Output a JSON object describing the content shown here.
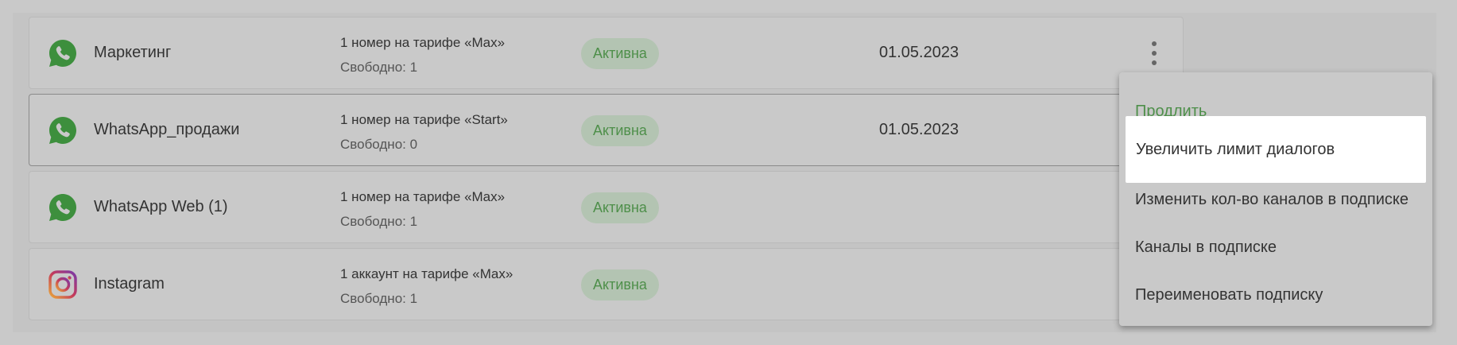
{
  "subscriptions": [
    {
      "icon": "whatsapp-icon",
      "name": "Маркетинг",
      "plan": "1 номер на тарифе «Max»",
      "free": "Свободно: 1",
      "status": "Активна",
      "date": "01.05.2023"
    },
    {
      "icon": "whatsapp-icon",
      "name": "WhatsApp_продажи",
      "plan": "1 номер на тарифе «Start»",
      "free": "Свободно: 0",
      "status": "Активна",
      "date": "01.05.2023"
    },
    {
      "icon": "whatsapp-icon",
      "name": "WhatsApp Web (1)",
      "plan": "1 номер на тарифе «Max»",
      "free": "Свободно: 1",
      "status": "Активна",
      "date": ""
    },
    {
      "icon": "instagram-icon",
      "name": "Instagram",
      "plan": "1 аккаунт на тарифе «Max»",
      "free": "Свободно: 1",
      "status": "Активна",
      "date": ""
    }
  ],
  "context_menu": {
    "items": [
      "Продлить",
      "Увеличить лимит диалогов",
      "Изменить кол-во каналов в подписке",
      "Каналы в подписке",
      "Переименовать подписку"
    ]
  },
  "colors": {
    "overlay_background": "#c9c9c9",
    "status_text": "#4e8f4a",
    "status_badge": "#b3c4b2",
    "whatsapp_green": "#3d8f3d",
    "menu_hover": "#ffffff"
  }
}
